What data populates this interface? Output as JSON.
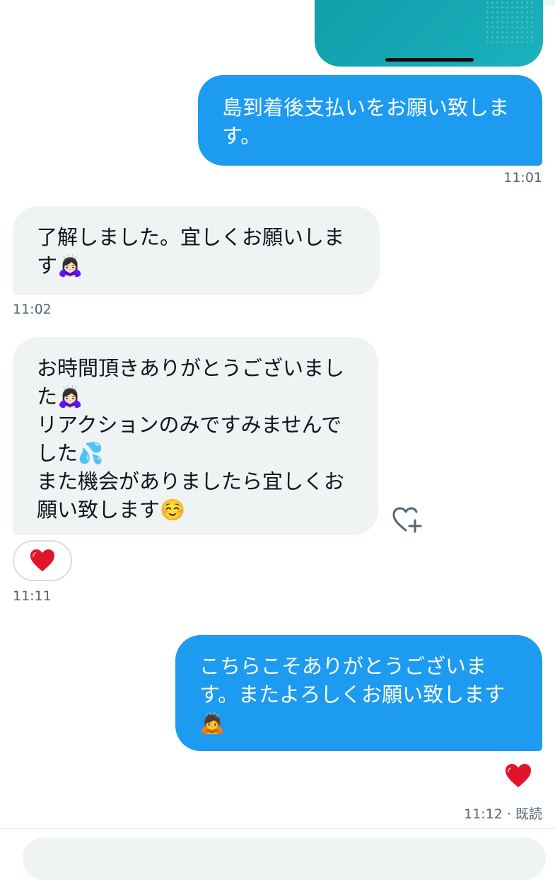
{
  "colors": {
    "outgoing_bubble": "#1d9bf0",
    "incoming_bubble": "#eff3f4",
    "timestamp": "#536471",
    "heart": "#f91880"
  },
  "messages": [
    {
      "direction": "out",
      "text": "島到着後支払いをお願い致しま\nす。",
      "time": "11:01"
    },
    {
      "direction": "in",
      "text": "了解しました。宜しくお願いしま\nす🙇🏻‍♀️",
      "time": "11:02"
    },
    {
      "direction": "in",
      "text": "お時間頂きありがとうございまし\nた🙇🏻‍♀️\nリアクションのみですみませんで\nした💦\nまた機会がありましたら宜しくお\n願い致します☺️",
      "time": "11:11",
      "reaction": "heart-icon",
      "add_reaction_icon": "heart-plus-icon"
    },
    {
      "direction": "out",
      "text": "こちらこそありがとうございま\nす。またよろしくお願い致します\n🙇",
      "time": "11:12 · 既読",
      "reaction": "heart-icon"
    }
  ],
  "composer": {
    "placeholder": ""
  }
}
